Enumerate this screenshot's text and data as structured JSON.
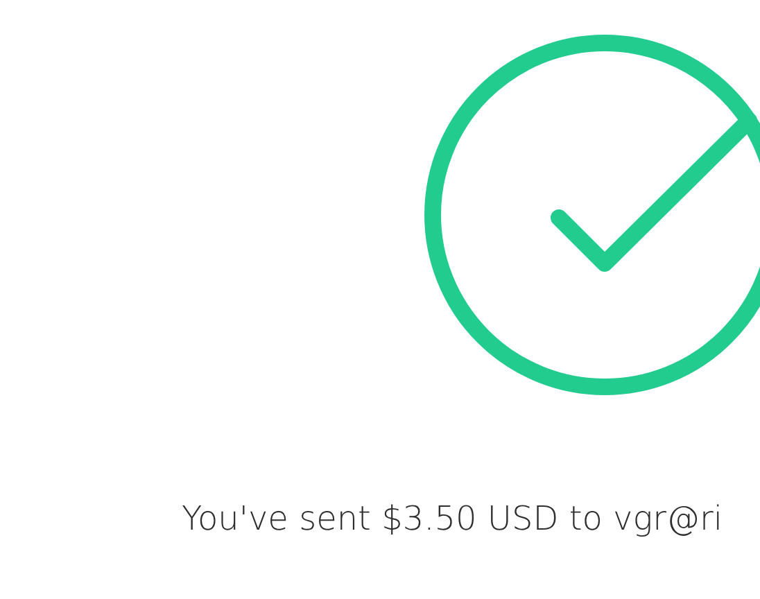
{
  "message": "You've sent $3.50 USD to vgr@ri"
}
